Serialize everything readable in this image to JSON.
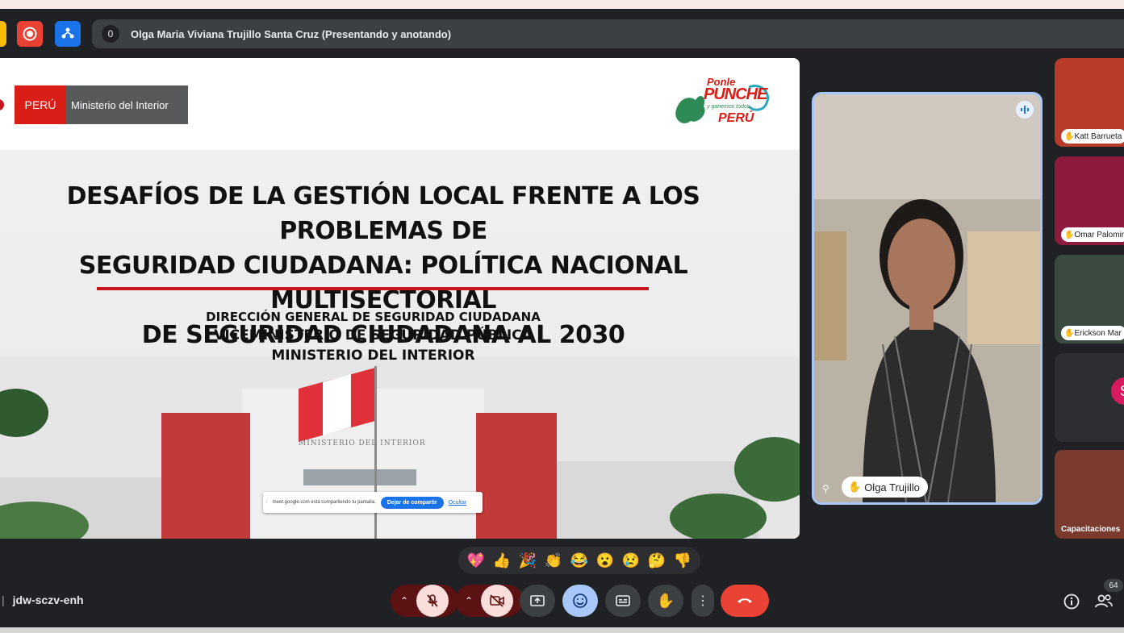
{
  "topbar": {
    "participant_count_badge": "0",
    "presenter_label": "Olga Maria Viviana Trujillo Santa Cruz (Presentando y anotando)",
    "icons": [
      "record-icon",
      "activities-icon"
    ]
  },
  "slide": {
    "peru_label": "PERÚ",
    "ministry_label": "Ministerio del Interior",
    "logo_text": {
      "line1": "Ponle",
      "line2": "PUNCHE",
      "line3": "y ganemos todos",
      "line4": "PERÚ"
    },
    "title_lines": [
      "DESAFÍOS DE LA GESTIÓN LOCAL FRENTE A LOS PROBLEMAS DE",
      "SEGURIDAD CIUDADANA: POLÍTICA NACIONAL MULTISECTORIAL",
      "DE SEGURIDAD CIUDADANA AL 2030"
    ],
    "subtitles": [
      "DIRECCIÓN GENERAL DE SEGURIDAD CIUDADANA",
      "VICEMINISTERIO DE SEGURIDAD PÚBLICA",
      "MINISTERIO DEL INTERIOR"
    ],
    "building_sign": "MINISTERIO DEL INTERIOR",
    "share_bar": {
      "message": "meet.google.com está compartiendo tu pantalla.",
      "stop_label": "Dejar de compartir",
      "hide_label": "Ocultar"
    }
  },
  "main_participant": {
    "name": "Olga Trujillo"
  },
  "side_participants": [
    {
      "name": "Katt Barrueta",
      "color": "#c0392b"
    },
    {
      "name": "Omar Palomir",
      "color": "#8e1b3e"
    },
    {
      "name": "Erickson Mar",
      "color": "#3b4a40"
    },
    {
      "name": "S",
      "color": "#2d2e31"
    },
    {
      "name": "Capacitaciones",
      "color": "#7a3b2e"
    }
  ],
  "reactions": [
    "💖",
    "👍",
    "🎉",
    "👏",
    "😂",
    "😮",
    "😢",
    "🤔",
    "👎"
  ],
  "bottom": {
    "meeting_code": "jdw-sczv-enh",
    "people_count": "64"
  },
  "colors": {
    "end_call": "#ea4335",
    "mic_off": "#f9dedc",
    "accent_blue": "#a8c7fa",
    "record_red": "#e94235",
    "activities_blue": "#1a73e8"
  }
}
